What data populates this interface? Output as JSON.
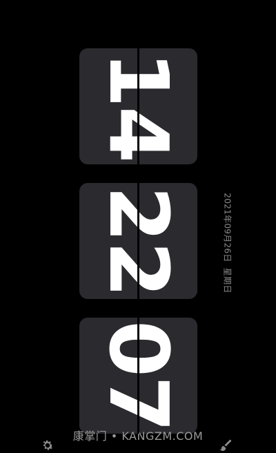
{
  "clock": {
    "hours": "14",
    "minutes": "22",
    "seconds": "07"
  },
  "date": {
    "date_text": "2021年09月26日",
    "weekday": "星期日"
  },
  "watermark": {
    "text": "康掌门 • KANGZM.COM"
  },
  "icons": {
    "left": "settings-gear-icon",
    "right": "theme-brush-icon"
  },
  "colors": {
    "background": "#000000",
    "card": "#2b2a2f",
    "digits": "#ffffff",
    "date_text": "#8a8a8a"
  }
}
